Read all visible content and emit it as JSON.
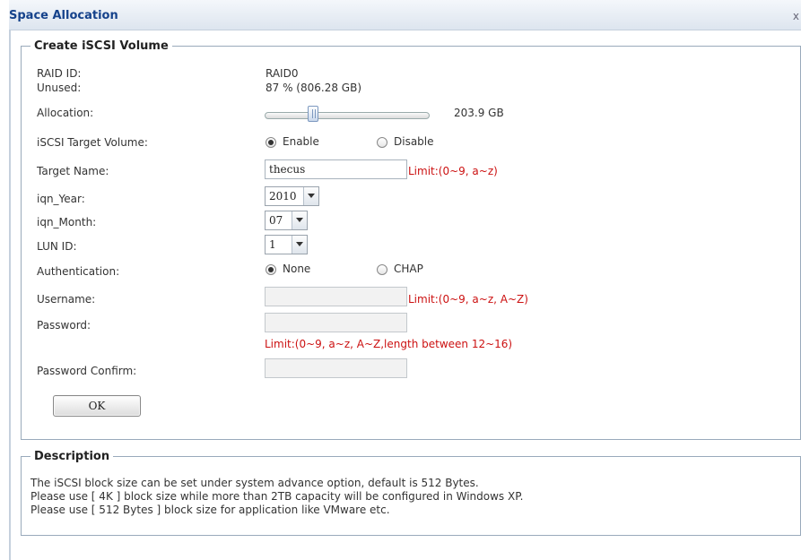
{
  "window": {
    "title": "Space Allocation",
    "close_label": "x"
  },
  "create": {
    "legend": "Create iSCSI Volume",
    "raid_id_label": "RAID ID:",
    "raid_id_value": "RAID0",
    "unused_label": "Unused:",
    "unused_value": "87 % (806.28 GB)",
    "allocation_label": "Allocation:",
    "allocation_value": "203.9 GB",
    "allocation_slider_fraction": 0.28,
    "target_volume_label": "iSCSI Target Volume:",
    "enable_label": "Enable",
    "disable_label": "Disable",
    "target_volume_selected": "Enable",
    "target_name_label": "Target Name:",
    "target_name_value": "thecus",
    "target_name_limit": "Limit:(0~9, a~z)",
    "iqn_year_label": "iqn_Year:",
    "iqn_year_value": "2010",
    "iqn_month_label": "iqn_Month:",
    "iqn_month_value": "07",
    "lun_id_label": "LUN ID:",
    "lun_id_value": "1",
    "authentication_label": "Authentication:",
    "auth_none_label": "None",
    "auth_chap_label": "CHAP",
    "authentication_selected": "None",
    "username_label": "Username:",
    "username_value": "",
    "username_limit": "Limit:(0~9, a~z, A~Z)",
    "password_label": "Password:",
    "password_value": "",
    "password_limit": "Limit:(0~9, a~z, A~Z,length between 12~16)",
    "password_confirm_label": "Password Confirm:",
    "password_confirm_value": "",
    "ok_label": "OK"
  },
  "description": {
    "legend": "Description",
    "lines": [
      "The iSCSI block size can be set under system advance option, default is 512 Bytes.",
      "Please use [ 4K ] block size while more than 2TB capacity will be configured in Windows XP.",
      "Please use [ 512 Bytes ] block size for application like VMware etc."
    ]
  },
  "colors": {
    "title_text": "#15428b",
    "limit_text": "#cc1111",
    "panel_border": "#99aabb"
  },
  "icons": {
    "close": "close-icon",
    "dropdown": "chevron-down-icon"
  }
}
